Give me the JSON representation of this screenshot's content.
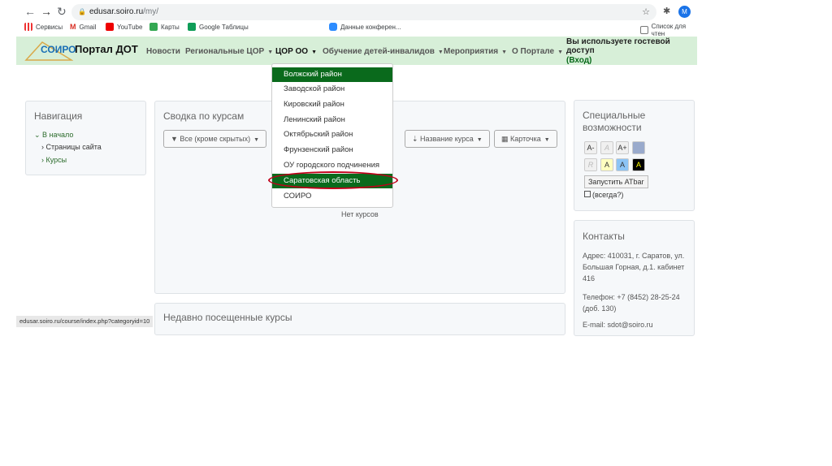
{
  "browser": {
    "url_host": "edusar.soiro.ru",
    "url_path": "/my/",
    "avatar": "M",
    "bookmarks": [
      "Сервисы",
      "Gmail",
      "YouTube",
      "Карты",
      "Google Таблицы",
      "Данные конферен..."
    ],
    "reading_list": "Список для чтен"
  },
  "header": {
    "logo": "СОИРО",
    "title": "Портал ДОТ",
    "nav": [
      "Новости",
      "Региональные ЦОР",
      "ЦОР ОО",
      "Обучение детей-инвалидов",
      "Мероприятия",
      "О Портале"
    ],
    "guest": "Вы используете гостевой доступ",
    "login": "(Вход)"
  },
  "dropdown": {
    "items": [
      "Волжский район",
      "Заводской район",
      "Кировский район",
      "Ленинский район",
      "Октябрьский район",
      "Фрунзенский район",
      "ОУ городского подчинения",
      "Саратовская область",
      "СОИРО"
    ]
  },
  "navigation": {
    "title": "Навигация",
    "home": "В начало",
    "items": [
      "Страницы сайта",
      "Курсы"
    ]
  },
  "courses": {
    "title": "Сводка по курсам",
    "filter": "Все (кроме скрытых)",
    "sort": "Название курса",
    "view": "Карточка",
    "empty": "Нет курсов"
  },
  "recent": {
    "title": "Недавно посещенные курсы"
  },
  "accessibility": {
    "title": "Специальные возможности",
    "buttons": [
      "A-",
      "A",
      "A+",
      "R",
      "A",
      "A",
      "A"
    ],
    "launch": "Запустить ATbar",
    "always": "(всегда?)"
  },
  "contacts": {
    "title": "Контакты",
    "address": "Адрес: 410031, г. Саратов, ул. Большая Горная, д.1. кабинет 416",
    "phone": "Телефон: +7 (8452) 28-25-24 (доб. 130)",
    "email": "E-mail: sdot@soiro.ru"
  },
  "status_url": "edusar.soiro.ru/course/index.php?categoryid=10",
  "colors": {
    "nav_bg": "#d7efd8",
    "accent": "#0a6a1c",
    "highlight": "#c0001a"
  }
}
